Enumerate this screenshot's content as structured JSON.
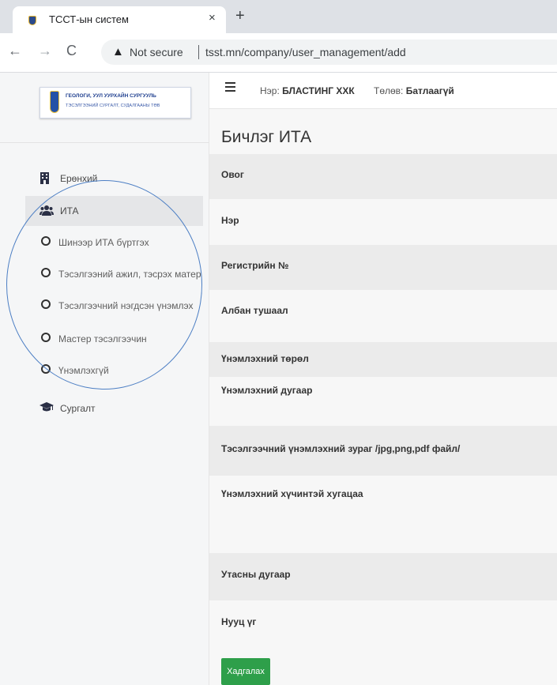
{
  "browser": {
    "tab_title": "ТССТ-ын систем",
    "tab_close": "×",
    "new_tab": "+",
    "back": "←",
    "forward": "→",
    "reload": "C",
    "warning": "▲",
    "not_secure": "Not secure",
    "url": "tsst.mn/company/user_management/add"
  },
  "logo": {
    "line1": "ГЕОЛОГИ, УУЛ УУРХАЙН СУРГУУЛЬ",
    "line2": "ТЭСЭЛГЭЭНИЙ СУРГАЛТ, СУДАЛГААНЫ ТӨВ"
  },
  "sidebar": {
    "items": [
      {
        "label": "Ерөнхий",
        "icon": "building-icon"
      },
      {
        "label": "ИТА",
        "icon": "users-icon"
      },
      {
        "label": "Шинээр ИТА бүртгэх",
        "icon": "circle-icon"
      },
      {
        "label": "Тэсэлгээний ажил, тэсрэх матер",
        "icon": "circle-icon"
      },
      {
        "label": "Тэсэлгээчний нэгдсэн үнэмлэх",
        "icon": "circle-icon"
      },
      {
        "label": "Мастер тэсэлгээчин",
        "icon": "circle-icon"
      },
      {
        "label": "Үнэмлэхгүй",
        "icon": "circle-icon"
      },
      {
        "label": "Сургалт",
        "icon": "graduation-cap-icon"
      }
    ]
  },
  "header": {
    "company_label": "Нэр:",
    "company_value": "БЛАСТИНГ ХХК",
    "status_label": "Төлөв:",
    "status_value": "Батлаагүй"
  },
  "form": {
    "title": "Бичлэг ИТА",
    "fields": [
      {
        "label": "Овог"
      },
      {
        "label": "Нэр"
      },
      {
        "label": "Регистрийн №"
      },
      {
        "label": "Албан тушаал"
      },
      {
        "label": "Үнэмлэхний төрөл"
      },
      {
        "label": "Үнэмлэхний дугаар"
      },
      {
        "label": "Тэсэлгээчний үнэмлэхний зураг /jpg,png,pdf файл/"
      },
      {
        "label": "Үнэмлэхний хүчинтэй хугацаа"
      },
      {
        "label": "Утасны дугаар"
      },
      {
        "label": "Нууц үг"
      }
    ],
    "save_label": "Хадгалах"
  },
  "colors": {
    "save_button": "#2e9f4a",
    "annotation": "#4d7fc4"
  }
}
